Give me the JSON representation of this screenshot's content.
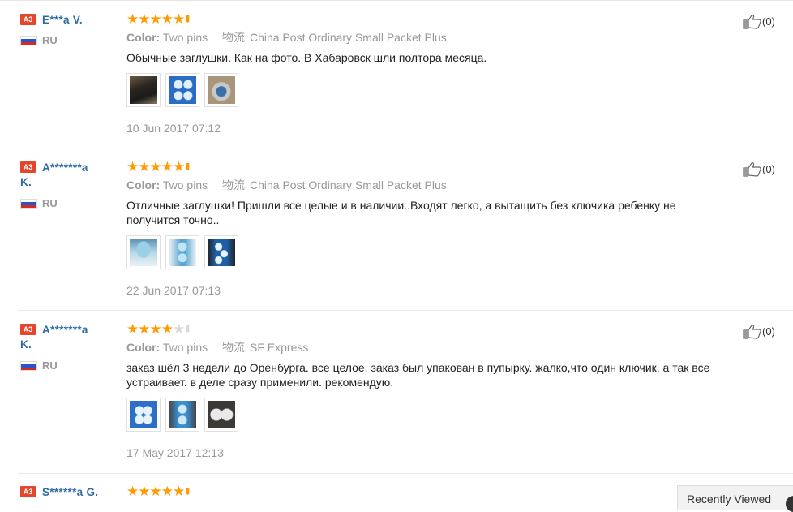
{
  "reviews": [
    {
      "level": "A3",
      "name_line1": "E***a V.",
      "name_line2": "",
      "country": "RU",
      "stars": [
        1,
        1,
        1,
        1,
        1
      ],
      "color_label": "Color:",
      "color_value": "Two pins",
      "shipping_label": "物流",
      "shipping_value": "China Post Ordinary Small Packet Plus",
      "text": "Обычные заглушки. Как на фото. В Хабаровск шли полтора месяца.",
      "date": "10 Jun 2017 07:12",
      "helpful": "(0)"
    },
    {
      "level": "A3",
      "name_line1": "A*******a",
      "name_line2": "K.",
      "country": "RU",
      "stars": [
        1,
        1,
        1,
        1,
        1
      ],
      "color_label": "Color:",
      "color_value": "Two pins",
      "shipping_label": "物流",
      "shipping_value": "China Post Ordinary Small Packet Plus",
      "text": "Отличные заглушки! Пришли все целые и в наличии..Входят легко, а вытащить без ключика ребенку не получится точно..",
      "date": "22 Jun 2017 07:13",
      "helpful": "(0)"
    },
    {
      "level": "A3",
      "name_line1": "A*******a",
      "name_line2": "K.",
      "country": "RU",
      "stars": [
        1,
        1,
        1,
        1,
        0
      ],
      "color_label": "Color:",
      "color_value": "Two pins",
      "shipping_label": "物流",
      "shipping_value": "SF Express",
      "text": "заказ шёл 3 недели до Оренбурга. все целое. заказ был упакован в пупырку. жалко,что один ключик, а так все устраивает. в деле сразу применили. рекомендую.",
      "date": "17 May 2017 12:13",
      "helpful": "(0)"
    },
    {
      "level": "A3",
      "name_line1": "S******a G.",
      "name_line2": "",
      "country": "",
      "stars": [
        1,
        1,
        1,
        1,
        1
      ]
    }
  ],
  "recently_viewed": "Recently Viewed",
  "colors": {
    "name": "#2e6da4",
    "star": "#ff9b00",
    "level_badge": "#e4462b"
  }
}
